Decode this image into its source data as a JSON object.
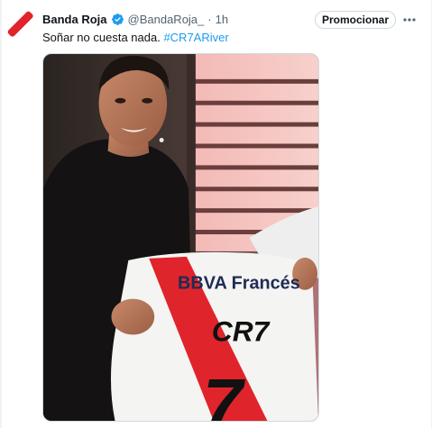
{
  "tweet": {
    "author_name": "Banda Roja",
    "handle": "@BandaRoja_",
    "separator": "·",
    "time": "1h",
    "promote_label": "Promocionar",
    "text": "Soñar no cuesta nada. ",
    "hashtag": "#CR7ARiver",
    "avatar_icon": "red-slash-logo",
    "verified_icon": "verified-badge-icon",
    "more_icon": "more-options-icon"
  },
  "media": {
    "jersey_sponsor": "BBVA Francés",
    "jersey_print": "CR7",
    "jersey_number": "7"
  },
  "colors": {
    "accent": "#1d9bf0",
    "brand_red": "#e0242c",
    "text_primary": "#0f1419",
    "text_secondary": "#536471"
  }
}
